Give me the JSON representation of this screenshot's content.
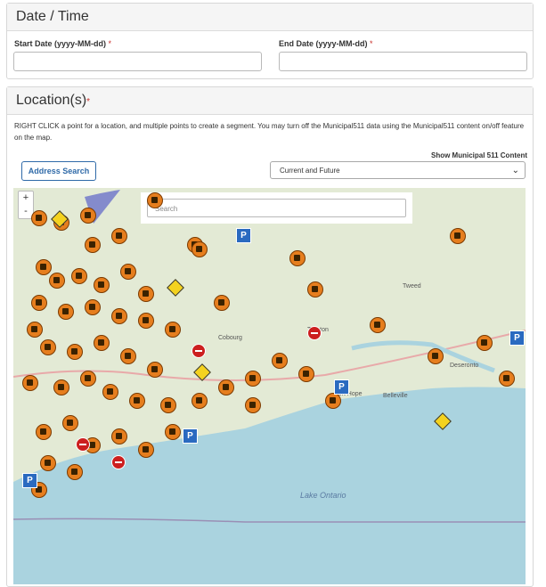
{
  "date_time": {
    "title": "Date / Time",
    "start_label": "Start Date (yyyy-MM-dd)",
    "end_label": "End Date (yyyy-MM-dd)",
    "required_mark": "*",
    "start_value": "",
    "end_value": ""
  },
  "locations": {
    "title": "Location(s)",
    "required_mark": "*",
    "instructions": "RIGHT CLICK a point for a location, and multiple points to create a segment. You may turn off the Municipal511 data using the Municipal511 content on/off feature on the map.",
    "address_search_label": "Address Search",
    "show_municipal_label": "Show Municipal 511 Content",
    "municipal_selected": "Current and Future",
    "map": {
      "search_placeholder": "Search",
      "zoom_in": "+",
      "zoom_out": "-",
      "labels": [
        "Tweed",
        "Belleville",
        "Deseronto",
        "Trenton",
        "Cobourg",
        "Port Hope",
        "Lake Ontario"
      ],
      "parking_icon_text": "P"
    }
  }
}
